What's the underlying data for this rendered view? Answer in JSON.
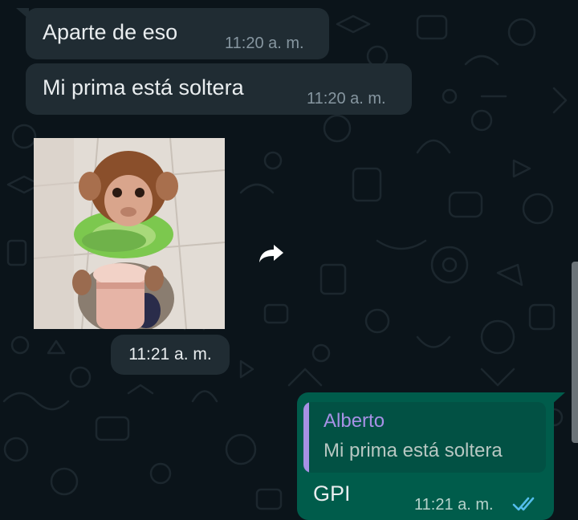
{
  "messages": [
    {
      "direction": "incoming",
      "text": "Aparte de eso",
      "time": "11:20 a. m."
    },
    {
      "direction": "incoming",
      "text": "Mi prima está soltera",
      "time": "11:20 a. m."
    },
    {
      "direction": "incoming",
      "type": "sticker",
      "sticker_icon": "baby-monkey-sticker",
      "time": "11:21 a. m."
    },
    {
      "direction": "outgoing",
      "reply_to": {
        "author": "Alberto",
        "text": "Mi prima está soltera"
      },
      "text": "GPI",
      "time": "11:21 a. m.",
      "status_icon": "double-check-read-icon"
    }
  ],
  "colors": {
    "background": "#0b141a",
    "incoming_bubble": "#202c33",
    "outgoing_bubble": "#005c4b",
    "quote_author": "#a791e6",
    "read_ticks": "#53bdeb"
  }
}
